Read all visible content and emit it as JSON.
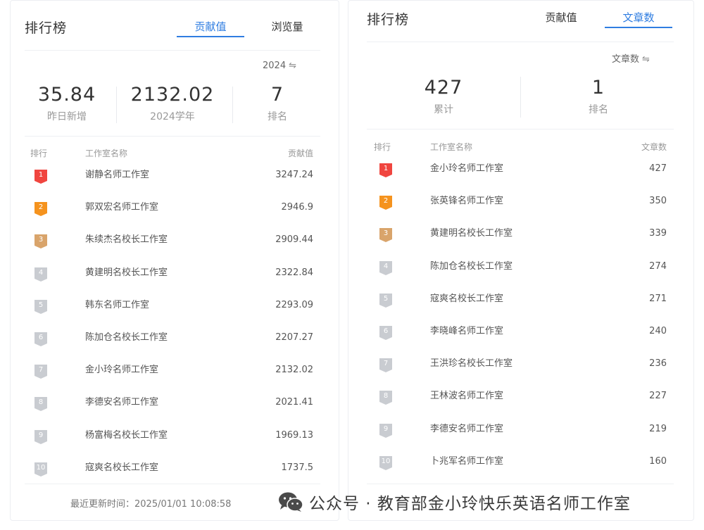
{
  "left_panel": {
    "title": "排行榜",
    "tabs": [
      {
        "label": "贡献值",
        "active": true
      },
      {
        "label": "浏览量",
        "active": false
      }
    ],
    "year_selector": "2024",
    "stats": [
      {
        "value": "35.84",
        "label": "昨日新增"
      },
      {
        "value": "2132.02",
        "label": "2024学年"
      },
      {
        "value": "7",
        "label": "排名"
      }
    ],
    "columns": {
      "rank": "排行",
      "name": "工作室名称",
      "value": "贡献值"
    },
    "rows": [
      {
        "rank": "1",
        "name": "谢静名师工作室",
        "value": "3247.24"
      },
      {
        "rank": "2",
        "name": "郭双宏名师工作室",
        "value": "2946.9"
      },
      {
        "rank": "3",
        "name": "朱续杰名校长工作室",
        "value": "2909.44"
      },
      {
        "rank": "4",
        "name": "黄建明名校长工作室",
        "value": "2322.84"
      },
      {
        "rank": "5",
        "name": "韩东名师工作室",
        "value": "2293.09"
      },
      {
        "rank": "6",
        "name": "陈加仓名校长工作室",
        "value": "2207.27"
      },
      {
        "rank": "7",
        "name": "金小玲名师工作室",
        "value": "2132.02"
      },
      {
        "rank": "8",
        "name": "李德安名师工作室",
        "value": "2021.41"
      },
      {
        "rank": "9",
        "name": "杨富梅名校长工作室",
        "value": "1969.13"
      },
      {
        "rank": "10",
        "name": "寇爽名校长工作室",
        "value": "1737.5"
      }
    ],
    "footer": "最近更新时间：2025/01/01 10:08:58"
  },
  "right_panel": {
    "title": "排行榜",
    "tabs": [
      {
        "label": "贡献值",
        "active": false
      },
      {
        "label": "文章数",
        "active": true
      }
    ],
    "type_selector": "文章数",
    "stats": [
      {
        "value": "427",
        "label": "累计"
      },
      {
        "value": "1",
        "label": "排名"
      }
    ],
    "columns": {
      "rank": "排行",
      "name": "工作室名称",
      "value": "文章数"
    },
    "rows": [
      {
        "rank": "1",
        "name": "金小玲名师工作室",
        "value": "427"
      },
      {
        "rank": "2",
        "name": "张英锋名师工作室",
        "value": "350"
      },
      {
        "rank": "3",
        "name": "黄建明名校长工作室",
        "value": "339"
      },
      {
        "rank": "4",
        "name": "陈加仓名校长工作室",
        "value": "274"
      },
      {
        "rank": "5",
        "name": "寇爽名校长工作室",
        "value": "271"
      },
      {
        "rank": "6",
        "name": "李晓峰名师工作室",
        "value": "240"
      },
      {
        "rank": "7",
        "name": "王洪珍名校长工作室",
        "value": "236"
      },
      {
        "rank": "8",
        "name": "王林波名师工作室",
        "value": "227"
      },
      {
        "rank": "9",
        "name": "李德安名师工作室",
        "value": "219"
      },
      {
        "rank": "10",
        "name": "卜兆军名师工作室",
        "value": "160"
      }
    ]
  },
  "watermark": {
    "icon": "wechat-icon",
    "text": "公众号 · 教育部金小玲快乐英语名师工作室"
  },
  "colors": {
    "accent": "#2f7de1",
    "rank1": "#f0453f",
    "rank2": "#f5931e",
    "rank3": "#d9a46b",
    "rank_other": "#c9ccd1"
  }
}
